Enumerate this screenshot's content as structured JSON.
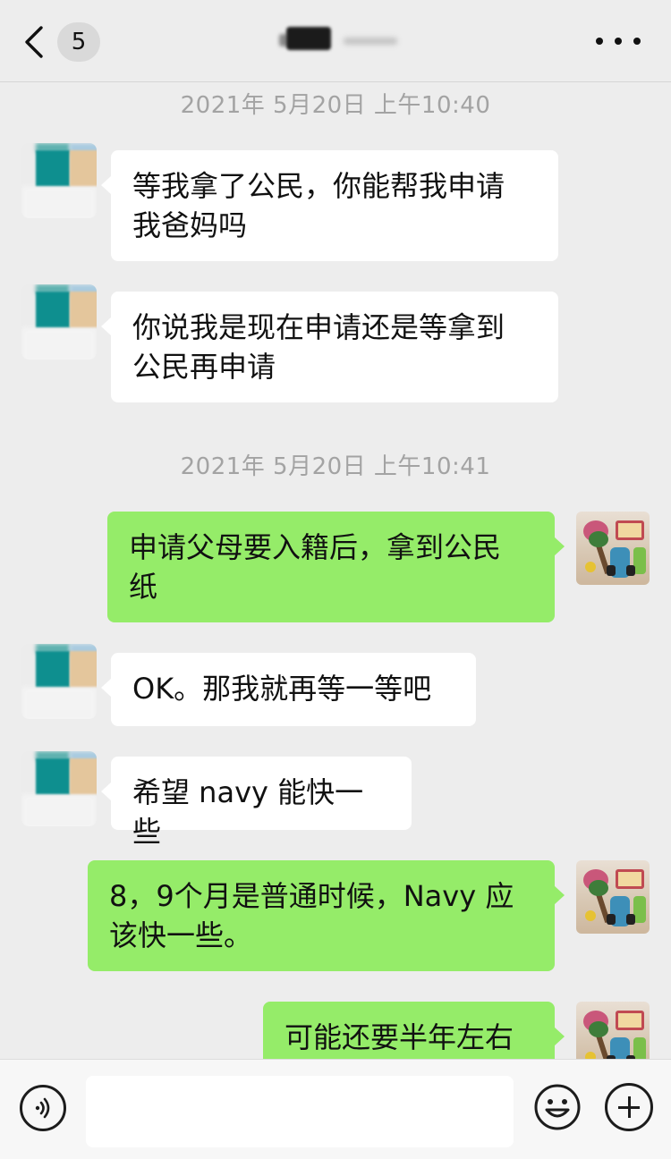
{
  "header": {
    "unread_count": "5",
    "back_icon": "chevron-left-icon",
    "more_icon": "more-dots-icon",
    "title_redacted": true
  },
  "timestamps": [
    "2021年 5月20日 上午10:40",
    "2021年 5月20日 上午10:41"
  ],
  "messages": [
    {
      "side": "left",
      "text": "等我拿了公民，你能帮我申请\n我爸妈吗"
    },
    {
      "side": "left",
      "text": "你说我是现在申请还是等拿到\n公民再申请"
    },
    {
      "side": "right",
      "text": "申请父母要入籍后，拿到公民\n纸"
    },
    {
      "side": "left",
      "text": "OK。那我就再等一等吧"
    },
    {
      "side": "left",
      "text": "希望 navy 能快一些"
    },
    {
      "side": "right",
      "text": "8，9个月是普通时候，Navy 应\n该快一些。"
    },
    {
      "side": "right",
      "text": "可能还要半年左右"
    }
  ],
  "input_bar": {
    "voice_icon": "voice-icon",
    "text_value": "",
    "emoji_icon": "emoji-icon",
    "plus_icon": "plus-icon"
  },
  "colors": {
    "background": "#ededed",
    "bubble_left": "#ffffff",
    "bubble_right": "#95ec69",
    "timestamp": "#a3a3a3"
  }
}
